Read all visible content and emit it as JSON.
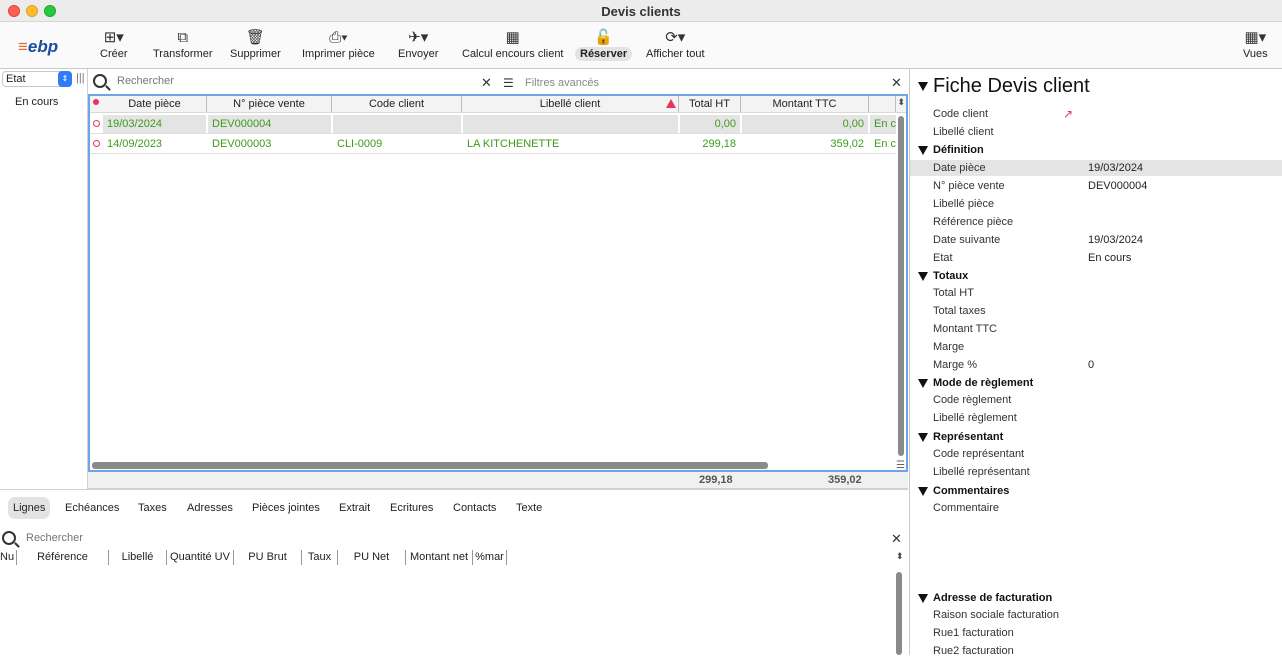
{
  "window": {
    "title": "Devis clients"
  },
  "logo": {
    "text": "ebp",
    "bars": "≡"
  },
  "toolbar": {
    "creer": "Créer",
    "transformer": "Transformer",
    "supprimer": "Supprimer",
    "imprimer": "Imprimer pièce",
    "envoyer": "Envoyer",
    "calcul": "Calcul encours client",
    "reserver": "Réserver",
    "afficher": "Afficher tout",
    "vues": "Vues"
  },
  "left_pane": {
    "select_value": "Etat",
    "item": "En cours"
  },
  "search": {
    "placeholder": "Rechercher",
    "filters": "Filtres avancés"
  },
  "grid": {
    "headers": [
      "Date pièce",
      "N° pièce vente",
      "Code client",
      "Libellé client",
      "Total HT",
      "Montant TTC"
    ],
    "rows": [
      {
        "date": "19/03/2024",
        "numero": "DEV000004",
        "code": "",
        "libelle": "",
        "total_ht": "0,00",
        "ttc": "0,00",
        "etat": "En c"
      },
      {
        "date": "14/09/2023",
        "numero": "DEV000003",
        "code": "CLI-0009",
        "libelle": "LA KITCHENETTE",
        "total_ht": "299,18",
        "ttc": "359,02",
        "etat": "En c"
      }
    ],
    "totals": {
      "total_ht": "299,18",
      "ttc": "359,02"
    }
  },
  "tabs": [
    "Lignes",
    "Echéances",
    "Taxes",
    "Adresses",
    "Pièces jointes",
    "Extrait",
    "Ecritures",
    "Contacts",
    "Texte"
  ],
  "lines": {
    "search_placeholder": "Rechercher",
    "headers": [
      "Nu",
      "Référence",
      "Libellé",
      "Quantité UV",
      "PU Brut",
      "Taux",
      "PU Net",
      "Montant net",
      "%mar"
    ]
  },
  "fiche": {
    "title": "Fiche Devis client",
    "code_client": "Code client",
    "libelle_client": "Libellé client",
    "sections": {
      "definition": "Définition",
      "totaux": "Totaux",
      "reglement": "Mode de règlement",
      "representant": "Représentant",
      "commentaires": "Commentaires",
      "adresse": "Adresse de facturation"
    },
    "fields": {
      "date_piece": "Date pièce",
      "num_piece": "N° pièce vente",
      "libelle_piece": "Libellé pièce",
      "reference_piece": "Référence pièce",
      "date_suivante": "Date suivante",
      "etat": "Etat",
      "total_ht": "Total HT",
      "total_taxes": "Total taxes",
      "montant_ttc": "Montant TTC",
      "marge": "Marge",
      "marge_pct": "Marge %",
      "code_reglement": "Code règlement",
      "libelle_reglement": "Libellé règlement",
      "code_representant": "Code représentant",
      "libelle_representant": "Libellé représentant",
      "commentaire": "Commentaire",
      "raison_sociale": "Raison sociale facturation",
      "rue1": "Rue1 facturation",
      "rue2": "Rue2 facturation"
    },
    "values": {
      "date_piece": "19/03/2024",
      "num_piece": "DEV000004",
      "date_suivante": "19/03/2024",
      "etat": "En cours",
      "marge_pct": "0"
    }
  }
}
